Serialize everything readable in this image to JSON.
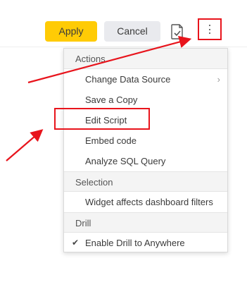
{
  "toolbar": {
    "apply_label": "Apply",
    "cancel_label": "Cancel",
    "doc_icon": "document-check-icon",
    "more_icon": "vertical-ellipsis-icon"
  },
  "menu": {
    "sections": [
      {
        "header": "Actions",
        "items": [
          {
            "label": "Change Data Source",
            "submenu": true
          },
          {
            "label": "Save a Copy"
          },
          {
            "label": "Edit Script"
          },
          {
            "label": "Embed code"
          },
          {
            "label": "Analyze SQL Query"
          }
        ]
      },
      {
        "header": "Selection",
        "items": [
          {
            "label": "Widget affects dashboard filters"
          }
        ]
      },
      {
        "header": "Drill",
        "items": [
          {
            "label": "Enable Drill to Anywhere",
            "checked": true
          }
        ]
      }
    ]
  },
  "colors": {
    "apply_bg": "#ffcb05",
    "cancel_bg": "#e9eaee",
    "annotation_red": "#e8141c",
    "section_header_bg": "#f4f4f4"
  }
}
